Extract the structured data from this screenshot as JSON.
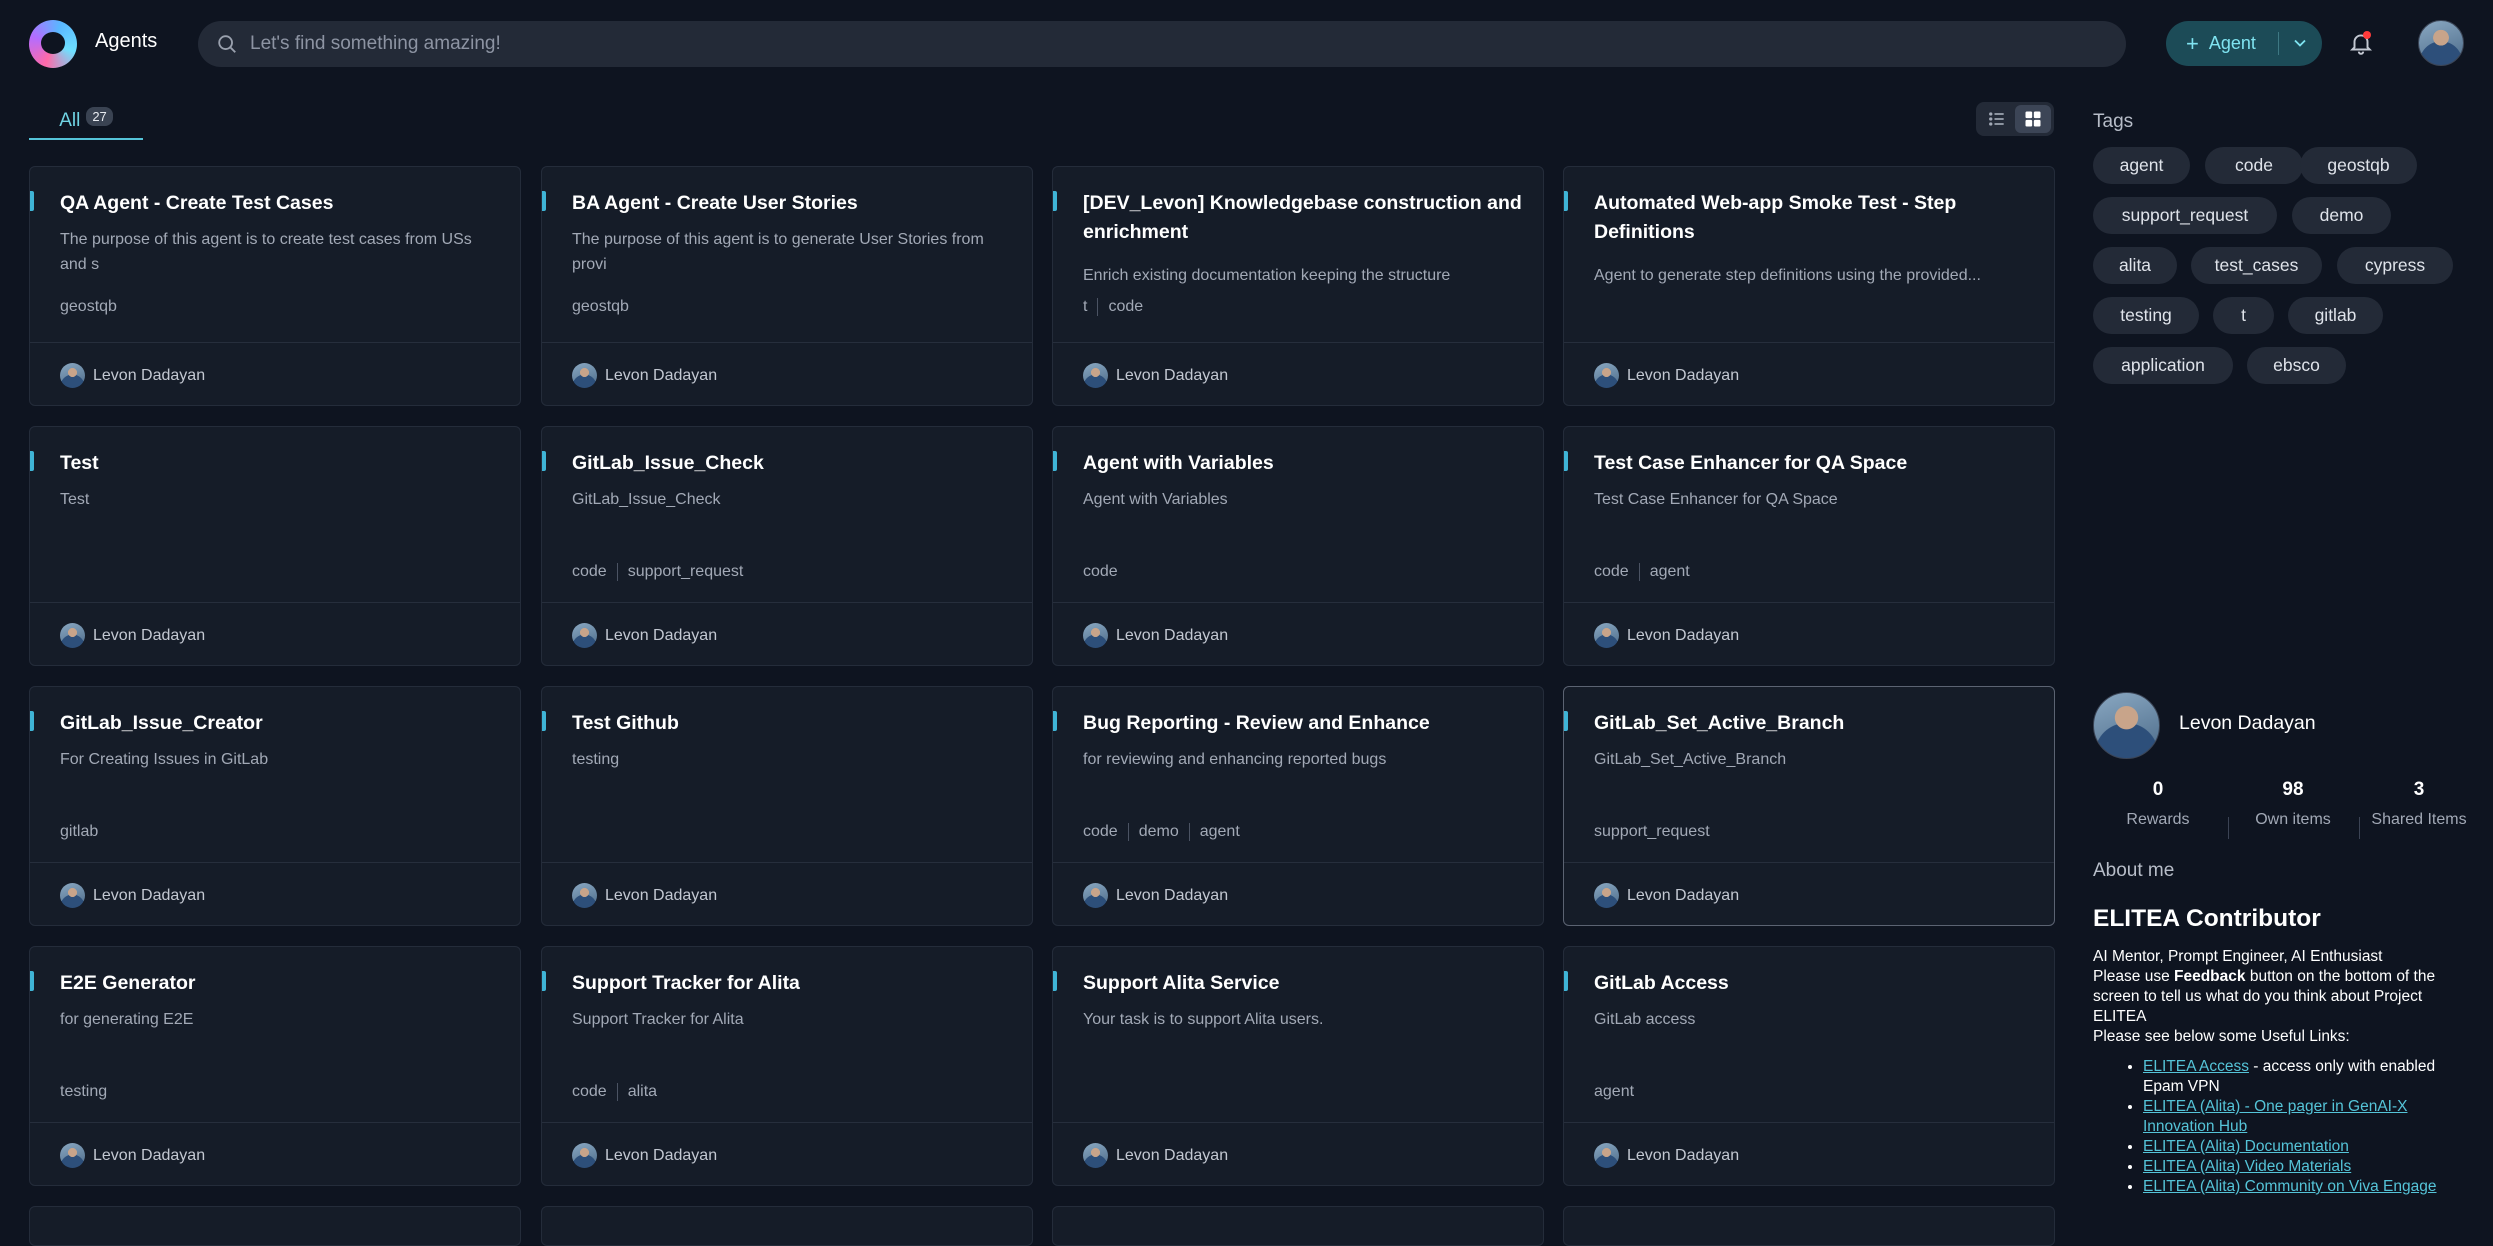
{
  "header": {
    "app_title": "Agents",
    "search_placeholder": "Let's find something amazing!",
    "agent_button_label": "Agent"
  },
  "tabs": {
    "all_label": "All",
    "all_count": "27"
  },
  "cards": [
    {
      "title": "QA Agent - Create Test Cases",
      "desc": "The purpose of this agent is to create test cases from USs and s",
      "tags": [
        "geostqb"
      ],
      "author": "Levon Dadayan"
    },
    {
      "title": "BA Agent - Create User Stories",
      "desc": "The purpose of this agent is to generate User Stories from provi",
      "tags": [
        "geostqb"
      ],
      "author": "Levon Dadayan"
    },
    {
      "title": "[DEV_Levon] Knowledgebase construction and enrichment",
      "desc": "Enrich existing documentation keeping the structure",
      "tags": [
        "t",
        "code"
      ],
      "author": "Levon Dadayan"
    },
    {
      "title": "Automated Web-app Smoke Test - Step Definitions",
      "desc": "Agent to generate step definitions using the provided...",
      "tags": [],
      "author": "Levon Dadayan"
    },
    {
      "title": "Test",
      "desc": "Test",
      "tags": [],
      "author": "Levon Dadayan"
    },
    {
      "title": "GitLab_Issue_Check",
      "desc": "GitLab_Issue_Check",
      "tags": [
        "code",
        "support_request"
      ],
      "author": "Levon Dadayan"
    },
    {
      "title": "Agent with Variables",
      "desc": "Agent with Variables",
      "tags": [
        "code"
      ],
      "author": "Levon Dadayan"
    },
    {
      "title": "Test Case Enhancer for QA Space",
      "desc": "Test Case Enhancer for QA Space",
      "tags": [
        "code",
        "agent"
      ],
      "author": "Levon Dadayan"
    },
    {
      "title": "GitLab_Issue_Creator",
      "desc": "For Creating Issues in GitLab",
      "tags": [
        "gitlab"
      ],
      "author": "Levon Dadayan"
    },
    {
      "title": "Test Github",
      "desc": "testing",
      "tags": [],
      "author": "Levon Dadayan"
    },
    {
      "title": "Bug Reporting - Review and Enhance",
      "desc": "for reviewing and enhancing reported bugs",
      "tags": [
        "code",
        "demo",
        "agent"
      ],
      "author": "Levon Dadayan"
    },
    {
      "title": "GitLab_Set_Active_Branch",
      "desc": "GitLab_Set_Active_Branch",
      "tags": [
        "support_request"
      ],
      "author": "Levon Dadayan"
    },
    {
      "title": "E2E Generator",
      "desc": "for generating E2E",
      "tags": [
        "testing"
      ],
      "author": "Levon Dadayan"
    },
    {
      "title": "Support Tracker for Alita",
      "desc": "Support Tracker for Alita",
      "tags": [
        "code",
        "alita"
      ],
      "author": "Levon Dadayan"
    },
    {
      "title": "Support Alita Service",
      "desc": "Your task is to support Alita users.",
      "tags": [],
      "author": "Levon Dadayan"
    },
    {
      "title": "GitLab Access",
      "desc": "GitLab access",
      "tags": [
        "agent"
      ],
      "author": "Levon Dadayan"
    }
  ],
  "sidebar": {
    "tags_title": "Tags",
    "tags": [
      "agent",
      "code",
      "geostqb",
      "support_request",
      "demo",
      "alita",
      "test_cases",
      "cypress",
      "testing",
      "t",
      "gitlab",
      "application",
      "ebsco"
    ],
    "profile": {
      "name": "Levon Dadayan",
      "stats": [
        {
          "value": "0",
          "label": "Rewards"
        },
        {
          "value": "98",
          "label": "Own items"
        },
        {
          "value": "3",
          "label": "Shared Items"
        }
      ]
    },
    "about_title": "About me",
    "contributor_title": "ELITEA Contributor",
    "about_line1": "AI Mentor, Prompt Engineer, AI Enthusiast",
    "about_line2_pre": "Please use ",
    "about_line2_bold": "Feedback",
    "about_line2_post": " button on the bottom of the screen to tell us what do you think about Project ELITEA",
    "about_line3": "Please see below some Useful Links:",
    "links": [
      {
        "text": "ELITEA Access",
        "suffix": " - access only with enabled Epam VPN"
      },
      {
        "text": "ELITEA (Alita) - One pager in GenAI-X Innovation Hub",
        "suffix": ""
      },
      {
        "text": "ELITEA (Alita) Documentation",
        "suffix": ""
      },
      {
        "text": "ELITEA (Alita) Video Materials",
        "suffix": ""
      },
      {
        "text": "ELITEA (Alita) Community on Viva Engage",
        "suffix": ""
      }
    ]
  },
  "colors": {
    "background": "#0e1420",
    "card": "#151c28",
    "accent": "#3fb4d6",
    "link": "#55c4d8"
  }
}
